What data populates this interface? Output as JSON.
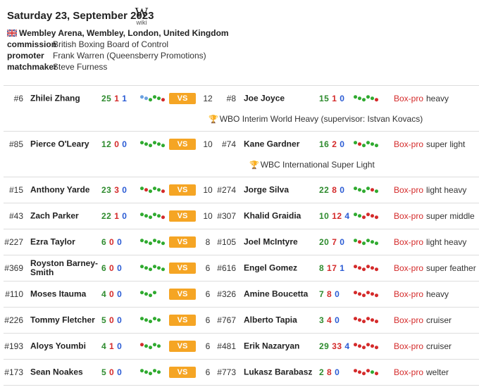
{
  "event": {
    "date": "Saturday 23, September 2023",
    "wiki_label": "wiki",
    "wiki_glyph": "W",
    "venue": "Wembley Arena, Wembley, London, United Kingdom",
    "commission_key": "commission",
    "commission": "British Boxing Board of Control",
    "promoter_key": "promoter",
    "promoter": "Frank Warren (Queensberry Promotions)",
    "matchmaker_key": "matchmaker",
    "matchmaker": "Steve Furness"
  },
  "vs_label": "VS",
  "bouts": [
    {
      "r1": "#6",
      "n1": "Zhilei Zhang",
      "w1": "25",
      "l1": "1",
      "d1": "1",
      "form1": "b,b,g,g,g,r",
      "vs": "VS",
      "rounds": "12",
      "r2": "#8",
      "n2": "Joe Joyce",
      "w2": "15",
      "l2": "1",
      "d2": "0",
      "form2": "g,g,g,g,g,r",
      "sport": "Box-pro",
      "wclass": "heavy",
      "title": "WBO Interim World Heavy (supervisor: Istvan Kovacs)"
    },
    {
      "r1": "#85",
      "n1": "Pierce O'Leary",
      "w1": "12",
      "l1": "0",
      "d1": "0",
      "form1": "g,g,g,g,g,g",
      "vs": "VS",
      "rounds": "10",
      "r2": "#74",
      "n2": "Kane Gardner",
      "w2": "16",
      "l2": "2",
      "d2": "0",
      "form2": "g,r,g,g,g,g",
      "sport": "Box-pro",
      "wclass": "super light",
      "title": "WBC International Super Light"
    },
    {
      "r1": "#15",
      "n1": "Anthony Yarde",
      "w1": "23",
      "l1": "3",
      "d1": "0",
      "form1": "g,r,g,g,g,r",
      "vs": "VS",
      "rounds": "10",
      "r2": "#274",
      "n2": "Jorge Silva",
      "w2": "22",
      "l2": "8",
      "d2": "0",
      "form2": "g,g,g,g,r,g",
      "sport": "Box-pro",
      "wclass": "light heavy",
      "title": ""
    },
    {
      "r1": "#43",
      "n1": "Zach Parker",
      "w1": "22",
      "l1": "1",
      "d1": "0",
      "form1": "g,g,g,g,g,r",
      "vs": "VS",
      "rounds": "10",
      "r2": "#307",
      "n2": "Khalid Graidia",
      "w2": "10",
      "l2": "12",
      "d2": "4",
      "form2": "g,g,r,r,r,r",
      "sport": "Box-pro",
      "wclass": "super middle",
      "title": ""
    },
    {
      "r1": "#227",
      "n1": "Ezra Taylor",
      "w1": "6",
      "l1": "0",
      "d1": "0",
      "form1": "g,g,g,g,g,g",
      "vs": "VS",
      "rounds": "8",
      "r2": "#105",
      "n2": "Joel McIntyre",
      "w2": "20",
      "l2": "7",
      "d2": "0",
      "form2": "g,r,g,g,g,g",
      "sport": "Box-pro",
      "wclass": "light heavy",
      "title": ""
    },
    {
      "r1": "#369",
      "n1": "Royston Barney-Smith",
      "w1": "6",
      "l1": "0",
      "d1": "0",
      "form1": "g,g,g,g,g,g",
      "vs": "VS",
      "rounds": "6",
      "r2": "#616",
      "n2": "Engel Gomez",
      "w2": "8",
      "l2": "17",
      "d2": "1",
      "form2": "r,r,r,r,r,r",
      "sport": "Box-pro",
      "wclass": "super feather",
      "title": ""
    },
    {
      "r1": "#110",
      "n1": "Moses Itauma",
      "w1": "4",
      "l1": "0",
      "d1": "0",
      "form1": "g,g,g,g",
      "vs": "VS",
      "rounds": "6",
      "r2": "#326",
      "n2": "Amine Boucetta",
      "w2": "7",
      "l2": "8",
      "d2": "0",
      "form2": "r,r,r,r,r,r",
      "sport": "Box-pro",
      "wclass": "heavy",
      "title": ""
    },
    {
      "r1": "#226",
      "n1": "Tommy Fletcher",
      "w1": "5",
      "l1": "0",
      "d1": "0",
      "form1": "g,g,g,g,g",
      "vs": "VS",
      "rounds": "6",
      "r2": "#767",
      "n2": "Alberto Tapia",
      "w2": "3",
      "l2": "4",
      "d2": "0",
      "form2": "r,r,r,r,r,r",
      "sport": "Box-pro",
      "wclass": "cruiser",
      "title": ""
    },
    {
      "r1": "#193",
      "n1": "Aloys Youmbi",
      "w1": "4",
      "l1": "1",
      "d1": "0",
      "form1": "r,g,g,g,g",
      "vs": "VS",
      "rounds": "6",
      "r2": "#481",
      "n2": "Erik Nazaryan",
      "w2": "29",
      "l2": "33",
      "d2": "4",
      "form2": "r,r,r,r,r,r",
      "sport": "Box-pro",
      "wclass": "cruiser",
      "title": ""
    },
    {
      "r1": "#173",
      "n1": "Sean Noakes",
      "w1": "5",
      "l1": "0",
      "d1": "0",
      "form1": "g,g,g,g,g",
      "vs": "VS",
      "rounds": "6",
      "r2": "#773",
      "n2": "Lukasz Barabasz",
      "w2": "2",
      "l2": "8",
      "d2": "0",
      "form2": "r,r,r,r,g,r",
      "sport": "Box-pro",
      "wclass": "welter",
      "title": ""
    }
  ],
  "colors": {
    "win": "#2e8b2e",
    "loss": "#d42a2a",
    "draw": "#2a5bd4",
    "vs_bg": "#f5a524",
    "sport": "#d42a2a"
  },
  "icons": {
    "trophy": "trophy-icon",
    "flag": "uk-flag-icon",
    "wiki": "wikipedia-icon"
  }
}
